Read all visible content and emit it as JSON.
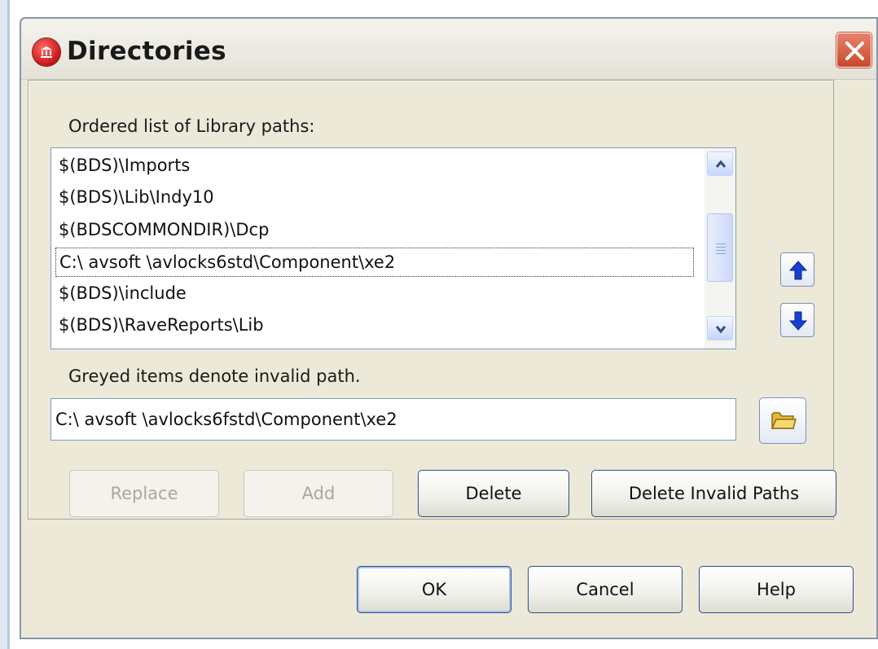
{
  "window": {
    "title": "Directories",
    "app_icon": "library-building-icon",
    "close_icon": "close-x-icon"
  },
  "list": {
    "label": "Ordered list of Library paths:",
    "items": [
      "$(BDS)\\Imports",
      "$(BDS)\\Lib\\Indy10",
      "$(BDSCOMMONDIR)\\Dcp",
      "C:\\ avsoft \\avlocks6std\\Component\\xe2",
      "$(BDS)\\include",
      "$(BDS)\\RaveReports\\Lib"
    ],
    "focused_index": 3,
    "scroll_up_icon": "chevron-up-icon",
    "scroll_down_icon": "chevron-down-icon"
  },
  "move": {
    "up_icon": "arrow-up-icon",
    "down_icon": "arrow-down-icon"
  },
  "note": "Greyed items denote invalid path.",
  "path_input": {
    "value": "C:\\ avsoft \\avlocks6fstd\\Component\\xe2",
    "browse_icon": "folder-icon"
  },
  "actions": {
    "replace": "Replace",
    "add": "Add",
    "delete": "Delete",
    "delete_invalid": "Delete Invalid Paths"
  },
  "footer": {
    "ok": "OK",
    "cancel": "Cancel",
    "help": "Help"
  },
  "colors": {
    "dialog_bg": "#ece9d8",
    "button_border": "#2f4e86",
    "disabled_text": "#aca899",
    "close_button": "#c9482a"
  }
}
